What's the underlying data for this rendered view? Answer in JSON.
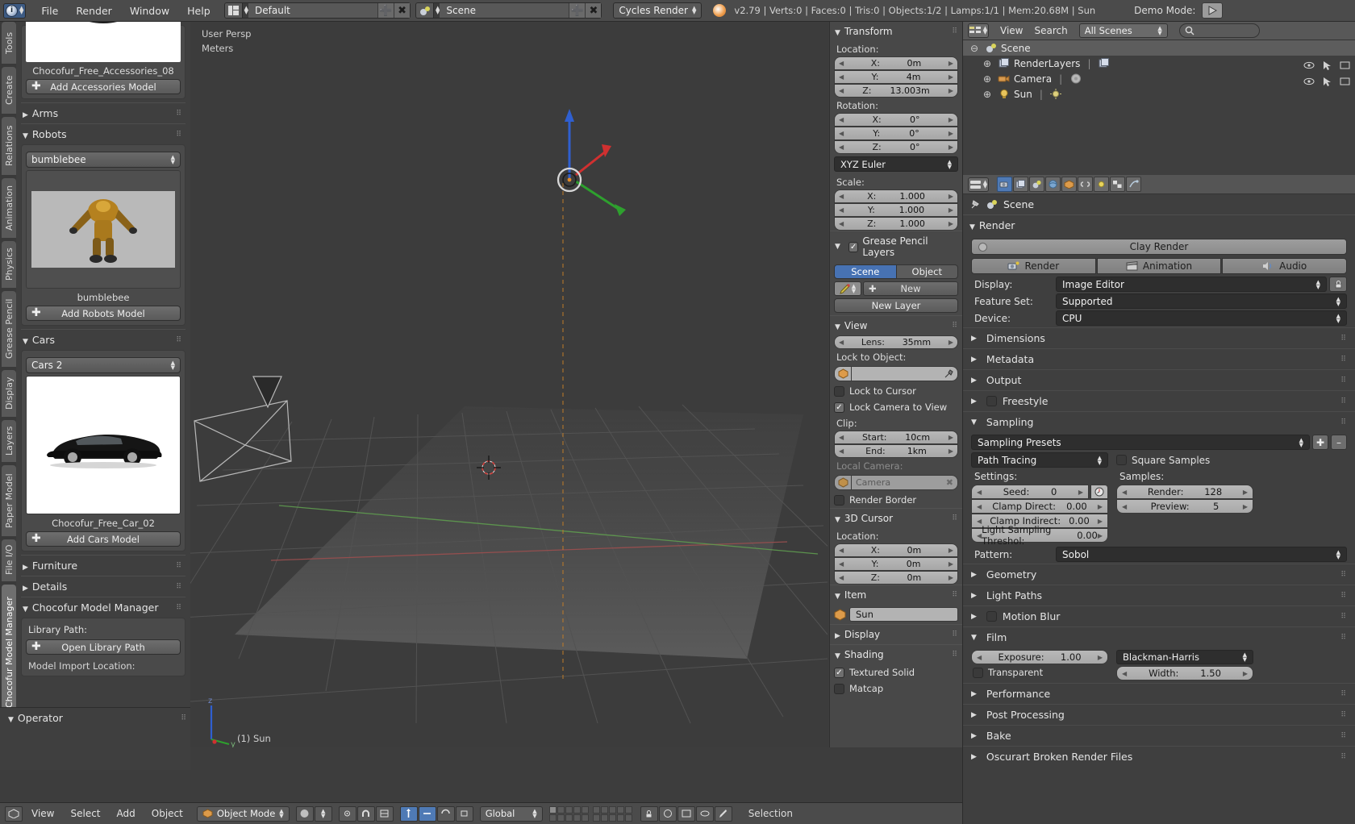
{
  "topbar": {
    "menus": [
      "File",
      "Render",
      "Window",
      "Help"
    ],
    "screen_layout": "Default",
    "scene_name": "Scene",
    "engine": "Cycles Render",
    "stats": "v2.79 | Verts:0 | Faces:0 | Tris:0 | Objects:1/2 | Lamps:1/1 | Mem:20.68M | Sun",
    "demo_label": "Demo Mode:",
    "play_icon": "play-icon",
    "add_icon": "plus-icon",
    "remove_icon": "x-icon"
  },
  "left_tabs": [
    {
      "label": "Tools",
      "active": false
    },
    {
      "label": "Create",
      "active": false
    },
    {
      "label": "Relations",
      "active": false
    },
    {
      "label": "Animation",
      "active": false
    },
    {
      "label": "Physics",
      "active": false
    },
    {
      "label": "Grease Pencil",
      "active": false
    },
    {
      "label": "Display",
      "active": false
    },
    {
      "label": "Layers",
      "active": false
    },
    {
      "label": "Paper Model",
      "active": false
    },
    {
      "label": "File I/O",
      "active": false
    },
    {
      "label": "Chocofur Model Manager",
      "active": true
    }
  ],
  "left_panel": {
    "accessories": {
      "caption": "Chocofur_Free_Accessories_08",
      "button": "Add Accessories Model"
    },
    "arms": {
      "label": "Arms",
      "expanded": false
    },
    "robots": {
      "label": "Robots",
      "expanded": true,
      "selected": "bumblebee",
      "caption": "bumblebee",
      "button": "Add Robots Model"
    },
    "cars": {
      "label": "Cars",
      "expanded": true,
      "selected": "Cars 2",
      "caption": "Chocofur_Free_Car_02",
      "button": "Add Cars Model"
    },
    "furniture": {
      "label": "Furniture",
      "expanded": false
    },
    "details": {
      "label": "Details",
      "expanded": false
    },
    "manager": {
      "label": "Chocofur Model Manager",
      "expanded": true,
      "library_path_label": "Library Path:",
      "library_button": "Open Library Path",
      "import_label": "Model Import Location:"
    },
    "operator": {
      "label": "Operator"
    }
  },
  "viewport": {
    "persp_label": "User Persp",
    "unit_label": "Meters",
    "object_label": "(1) Sun",
    "axis_z": "z",
    "axis_y": "y"
  },
  "npanel": {
    "transform": {
      "title": "Transform",
      "location_label": "Location:",
      "location": [
        {
          "axis": "X:",
          "value": "0m"
        },
        {
          "axis": "Y:",
          "value": "4m"
        },
        {
          "axis": "Z:",
          "value": "13.003m"
        }
      ],
      "rotation_label": "Rotation:",
      "rotation": [
        {
          "axis": "X:",
          "value": "0°"
        },
        {
          "axis": "Y:",
          "value": "0°"
        },
        {
          "axis": "Z:",
          "value": "0°"
        }
      ],
      "rotation_mode": "XYZ Euler",
      "scale_label": "Scale:",
      "scale": [
        {
          "axis": "X:",
          "value": "1.000"
        },
        {
          "axis": "Y:",
          "value": "1.000"
        },
        {
          "axis": "Z:",
          "value": "1.000"
        }
      ]
    },
    "grease_pencil": {
      "title": "Grease Pencil Layers",
      "checked": true,
      "tab_scene": "Scene",
      "tab_object": "Object",
      "new_button": "New",
      "new_layer_button": "New Layer"
    },
    "view": {
      "title": "View",
      "lens_label": "Lens:",
      "lens_value": "35mm",
      "lock_object_label": "Lock to Object:",
      "lock_object_value": "",
      "lock_cursor": "Lock to Cursor",
      "lock_cursor_checked": false,
      "lock_camera": "Lock Camera to View",
      "lock_camera_checked": true,
      "clip_label": "Clip:",
      "clip_start_label": "Start:",
      "clip_start_value": "10cm",
      "clip_end_label": "End:",
      "clip_end_value": "1km",
      "local_camera_label": "Local Camera:",
      "local_camera_value": "Camera",
      "render_border": "Render Border",
      "render_border_checked": false
    },
    "cursor": {
      "title": "3D Cursor",
      "location_label": "Location:",
      "location": [
        {
          "axis": "X:",
          "value": "0m"
        },
        {
          "axis": "Y:",
          "value": "0m"
        },
        {
          "axis": "Z:",
          "value": "0m"
        }
      ]
    },
    "item": {
      "title": "Item",
      "name": "Sun"
    },
    "display": {
      "title": "Display"
    },
    "shading": {
      "title": "Shading",
      "textured_solid": "Textured Solid",
      "textured_solid_checked": true,
      "matcap": "Matcap"
    }
  },
  "outliner": {
    "view_menu": "View",
    "search_menu": "Search",
    "display_mode": "All Scenes",
    "search_placeholder": "",
    "rows": [
      {
        "label": "Scene",
        "indent": 0,
        "icon": "scene-icon",
        "selected": true
      },
      {
        "label": "RenderLayers",
        "indent": 1,
        "icon": "renderlayers-icon",
        "selected": false
      },
      {
        "label": "Camera",
        "indent": 1,
        "icon": "camera-icon",
        "selected": false
      },
      {
        "label": "Sun",
        "indent": 1,
        "icon": "lamp-icon",
        "selected": false
      }
    ]
  },
  "properties": {
    "breadcrumb": "Scene",
    "tabs": [
      "render-tab",
      "renderlayers-tab",
      "scene-tab",
      "world-tab",
      "object-tab",
      "constraints-tab",
      "lamp-tab",
      "texture-tab",
      "particles-tab"
    ],
    "render": {
      "title": "Render",
      "clay_render": "Clay Render",
      "buttons": [
        "Render",
        "Animation",
        "Audio"
      ],
      "display_label": "Display:",
      "display_value": "Image Editor",
      "feature_set_label": "Feature Set:",
      "feature_set_value": "Supported",
      "device_label": "Device:",
      "device_value": "CPU"
    },
    "collapsed_sections": [
      {
        "label": "Dimensions",
        "checkbox": false
      },
      {
        "label": "Metadata",
        "checkbox": false
      },
      {
        "label": "Output",
        "checkbox": false
      },
      {
        "label": "Freestyle",
        "checkbox": true
      }
    ],
    "sampling": {
      "title": "Sampling",
      "presets_label": "Sampling Presets",
      "integrator": "Path Tracing",
      "square_samples": "Square Samples",
      "square_samples_checked": false,
      "settings_label": "Settings:",
      "samples_label": "Samples:",
      "settings": [
        {
          "label": "Seed:",
          "value": "0"
        },
        {
          "label": "Clamp Direct:",
          "value": "0.00"
        },
        {
          "label": "Clamp Indirect:",
          "value": "0.00"
        },
        {
          "label": "Light Sampling Threshol:",
          "value": "0.00"
        }
      ],
      "samples": [
        {
          "label": "Render:",
          "value": "128"
        },
        {
          "label": "Preview:",
          "value": "5"
        }
      ],
      "pattern_label": "Pattern:",
      "pattern_value": "Sobol"
    },
    "post_sections": [
      {
        "label": "Geometry",
        "checkbox": false
      },
      {
        "label": "Light Paths",
        "checkbox": false
      },
      {
        "label": "Motion Blur",
        "checkbox": true
      }
    ],
    "film": {
      "title": "Film",
      "exposure_label": "Exposure:",
      "exposure_value": "1.00",
      "filter_value": "Blackman-Harris",
      "width_label": "Width:",
      "width_value": "1.50",
      "transparent": "Transparent",
      "transparent_checked": false
    },
    "bottom_sections": [
      {
        "label": "Performance"
      },
      {
        "label": "Post Processing"
      },
      {
        "label": "Bake"
      },
      {
        "label": "Oscurart Broken Render Files"
      }
    ]
  },
  "bottombar": {
    "menus": [
      "View",
      "Select",
      "Add",
      "Object"
    ],
    "mode": "Object Mode",
    "orientation": "Global",
    "selection_text": "Selection"
  }
}
